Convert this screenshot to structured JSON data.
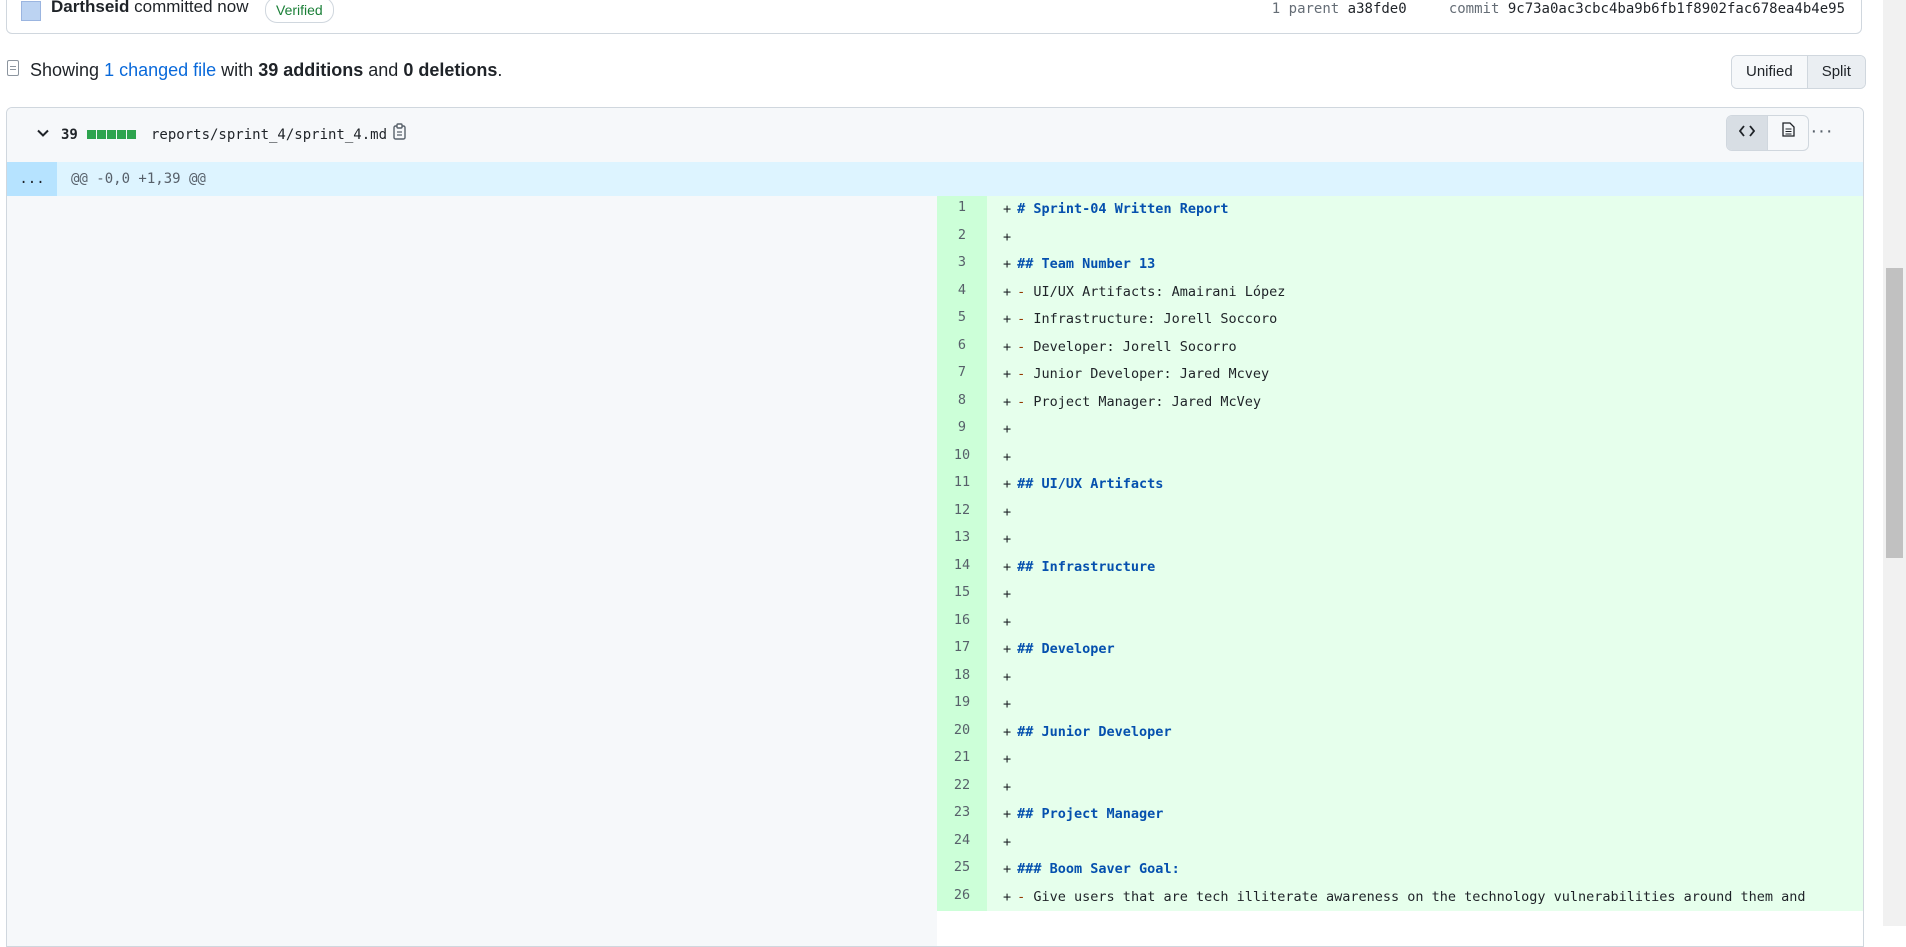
{
  "commit": {
    "author": "Darthseid",
    "action": "committed now",
    "verified_label": "Verified",
    "parent_label": "1 parent",
    "parent_sha": "a38fde0",
    "commit_label": "commit",
    "commit_sha": "9c73a0ac3cbc4ba9b6fb1f8902fac678ea4b4e95"
  },
  "summary": {
    "showing": "Showing",
    "changed_files": "1 changed file",
    "with": "with",
    "additions": "39 additions",
    "and": "and",
    "deletions": "0 deletions",
    "period": "."
  },
  "view_toggle": {
    "unified": "Unified",
    "split": "Split",
    "active": "split"
  },
  "file": {
    "additions_count": "39",
    "path": "reports/sprint_4/sprint_4.md",
    "hunk_expander": "...",
    "hunk_header": "@@ -0,0 +1,39 @@",
    "colors": {
      "add_line_bg": "#e6ffec",
      "add_num_bg": "#ccffd8",
      "hunk_bg": "#ddf4ff",
      "diffstat_green": "#2da44e"
    }
  },
  "diff_lines": [
    {
      "num": "1",
      "prefix": "+",
      "heading": "# Sprint-04 Written Report"
    },
    {
      "num": "2",
      "prefix": "+"
    },
    {
      "num": "3",
      "prefix": "+",
      "heading": "## Team Number 13"
    },
    {
      "num": "4",
      "prefix": "+",
      "bullet": "-",
      "text": "UI/UX Artifacts: Amairani López"
    },
    {
      "num": "5",
      "prefix": "+",
      "bullet": "-",
      "text": "Infrastructure: Jorell Soccoro"
    },
    {
      "num": "6",
      "prefix": "+",
      "bullet": "-",
      "text": "Developer: Jorell Socorro"
    },
    {
      "num": "7",
      "prefix": "+",
      "bullet": "-",
      "text": "Junior Developer: Jared Mcvey"
    },
    {
      "num": "8",
      "prefix": "+",
      "bullet": "-",
      "text": "Project Manager: Jared McVey"
    },
    {
      "num": "9",
      "prefix": "+"
    },
    {
      "num": "10",
      "prefix": "+"
    },
    {
      "num": "11",
      "prefix": "+",
      "heading": "## UI/UX Artifacts"
    },
    {
      "num": "12",
      "prefix": "+"
    },
    {
      "num": "13",
      "prefix": "+"
    },
    {
      "num": "14",
      "prefix": "+",
      "heading": "## Infrastructure"
    },
    {
      "num": "15",
      "prefix": "+"
    },
    {
      "num": "16",
      "prefix": "+"
    },
    {
      "num": "17",
      "prefix": "+",
      "heading": "## Developer"
    },
    {
      "num": "18",
      "prefix": "+"
    },
    {
      "num": "19",
      "prefix": "+"
    },
    {
      "num": "20",
      "prefix": "+",
      "heading": "## Junior Developer"
    },
    {
      "num": "21",
      "prefix": "+"
    },
    {
      "num": "22",
      "prefix": "+"
    },
    {
      "num": "23",
      "prefix": "+",
      "heading": "## Project Manager"
    },
    {
      "num": "24",
      "prefix": "+"
    },
    {
      "num": "25",
      "prefix": "+",
      "heading": "### Boom Saver Goal:"
    },
    {
      "num": "26",
      "prefix": "+",
      "bullet": "-",
      "text": "Give users that are tech illiterate awareness on the technology vulnerabilities around them and"
    }
  ]
}
